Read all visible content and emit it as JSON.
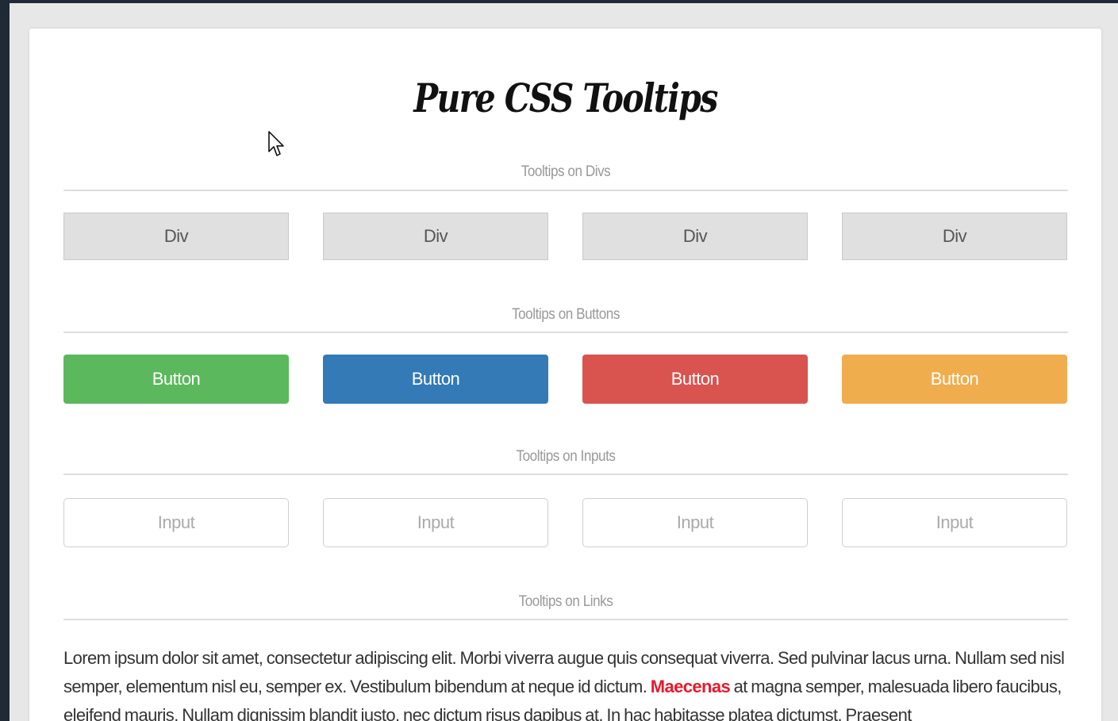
{
  "page": {
    "title": "Pure CSS Tooltips"
  },
  "sections": {
    "divs": {
      "heading": "Tooltips on Divs",
      "items": [
        "Div",
        "Div",
        "Div",
        "Div"
      ]
    },
    "buttons": {
      "heading": "Tooltips on Buttons",
      "items": [
        {
          "label": "Button",
          "color": "#5cb85c"
        },
        {
          "label": "Button",
          "color": "#337ab7"
        },
        {
          "label": "Button",
          "color": "#d9534f"
        },
        {
          "label": "Button",
          "color": "#f0ad4e"
        }
      ]
    },
    "inputs": {
      "heading": "Tooltips on Inputs",
      "placeholders": [
        "Input",
        "Input",
        "Input",
        "Input"
      ]
    },
    "links": {
      "heading": "Tooltips on Links",
      "text_before": "Lorem ipsum dolor sit amet, consectetur adipiscing elit. Morbi viverra augue quis consequat viverra. Sed pulvinar lacus urna. Nullam sed nisl semper, elementum nisl eu, semper ex. Vestibulum bibendum at neque id dictum. ",
      "link_text": "Maecenas",
      "text_after": " at magna semper, malesuada libero faucibus, eleifend mauris. Nullam dignissim blandit iusto, nec dictum risus dapibus at. In hac habitasse platea dictumst. Praesent",
      "link_color": "#e8192c"
    }
  },
  "colors": {
    "page_background": "#1f2a36",
    "content_background": "#e7e7e7",
    "card_background": "#ffffff"
  },
  "icons": {
    "cursor": "mouse-pointer-icon"
  }
}
